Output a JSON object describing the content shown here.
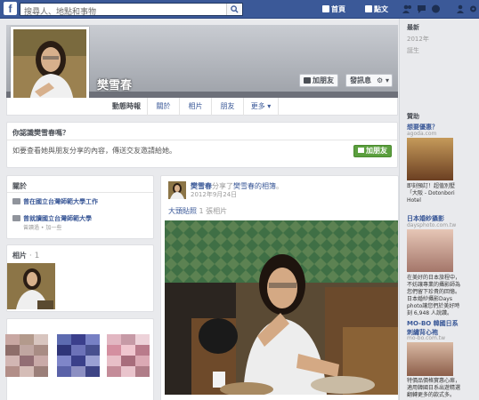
{
  "topbar": {
    "logo": "f",
    "search_placeholder": "搜尋人、地點和事物",
    "home_label": "首頁",
    "find_friends_label": "點文"
  },
  "profile": {
    "name": "樊雪春",
    "add_friend_button": "加朋友",
    "message_button": "發訊息",
    "gear_button": "⚙ ▾"
  },
  "tabs": [
    "動態時報",
    "關於",
    "相片",
    "朋友",
    "更多 ▾"
  ],
  "know_card": {
    "title": "你認識樊雪春嗎？",
    "text": "如要查看她與朋友分享的內容，傳送交友邀請給她。",
    "button": "加朋友"
  },
  "about_card": {
    "title": "關於",
    "items": [
      {
        "text": "曾在國立台灣師範大學工作"
      },
      {
        "text": "曾就讀國立台灣師範大學",
        "sub": "曾讀過 • 加一些"
      }
    ]
  },
  "photos_card": {
    "title": "相片",
    "count": "· 1"
  },
  "post": {
    "author": "樊雪春",
    "action": "分享了",
    "target": "樊雪春的相簿",
    "date": "2012年9月24日",
    "album": "大頭貼照",
    "album_count": "1 張相片"
  },
  "right_sidebar": {
    "years": [
      "最新",
      "2012年",
      "誕生"
    ],
    "sponsored": "贊助",
    "ads": [
      {
        "title": "想要優惠？",
        "url": "agoda.com",
        "text": "即刻預訂！超值別墅「大阪 - Dotonbori Hotel"
      },
      {
        "title": "日本婚紗攝影",
        "url": "daysphoto.com.tw",
        "text": "在美好的日本旅程中，不妨讓專業的攝影師為您們留下珍貴的回憶。日本婚紗攝影Days photo讓您們於美好時刻 6,948 人說讚。"
      },
      {
        "title": "MO-BO 韓國日系刺繡背心袍",
        "url": "mo-bo.com.tw",
        "text": "特價品價格實惠心扉，適用韓國日系出遊精選翻轉更多的款式多。"
      }
    ]
  }
}
